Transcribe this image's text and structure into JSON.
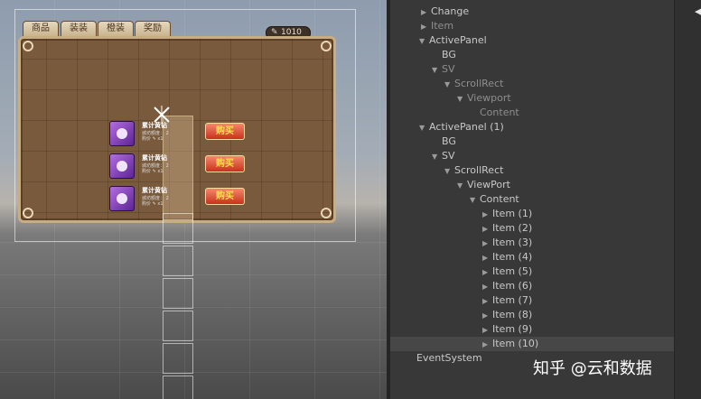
{
  "scene": {
    "tabs": [
      "商品",
      "装装",
      "橙装",
      "奖励"
    ],
    "coin_amount": "1010",
    "items": [
      {
        "title": "累计黄钻",
        "desc": "城坊额度： 2",
        "price_label": "购价",
        "price": "x1",
        "buy_label": "购买"
      },
      {
        "title": "累计黄钻",
        "desc": "城坊额度： 2",
        "price_label": "购价",
        "price": "x1",
        "buy_label": "购买"
      },
      {
        "title": "累计黄钻",
        "desc": "城坊额度： 2",
        "price_label": "购价",
        "price": "x1",
        "buy_label": "购买"
      }
    ]
  },
  "hierarchy": {
    "rows": [
      {
        "label": "Change",
        "expander": "right",
        "dim": false,
        "selected": false
      },
      {
        "label": "Item",
        "expander": "right",
        "dim": true,
        "selected": false
      },
      {
        "label": "ActivePanel",
        "expander": "down",
        "dim": false,
        "selected": false
      },
      {
        "label": "BG",
        "expander": "none",
        "dim": false,
        "selected": false
      },
      {
        "label": "SV",
        "expander": "down",
        "dim": true,
        "selected": false
      },
      {
        "label": "ScrollRect",
        "expander": "down",
        "dim": true,
        "selected": false
      },
      {
        "label": "Viewport",
        "expander": "down",
        "dim": true,
        "selected": false
      },
      {
        "label": "Content",
        "expander": "none",
        "dim": true,
        "selected": false
      },
      {
        "label": "ActivePanel (1)",
        "expander": "down",
        "dim": false,
        "selected": false
      },
      {
        "label": "BG",
        "expander": "none",
        "dim": false,
        "selected": false
      },
      {
        "label": "SV",
        "expander": "down",
        "dim": false,
        "selected": false
      },
      {
        "label": "ScrollRect",
        "expander": "down",
        "dim": false,
        "selected": false
      },
      {
        "label": "ViewPort",
        "expander": "down",
        "dim": false,
        "selected": false
      },
      {
        "label": "Content",
        "expander": "down",
        "dim": false,
        "selected": false
      },
      {
        "label": "Item (1)",
        "expander": "right",
        "dim": false,
        "selected": false
      },
      {
        "label": "Item (2)",
        "expander": "right",
        "dim": false,
        "selected": false
      },
      {
        "label": "Item (3)",
        "expander": "right",
        "dim": false,
        "selected": false
      },
      {
        "label": "Item (4)",
        "expander": "right",
        "dim": false,
        "selected": false
      },
      {
        "label": "Item (5)",
        "expander": "right",
        "dim": false,
        "selected": false
      },
      {
        "label": "Item (6)",
        "expander": "right",
        "dim": false,
        "selected": false
      },
      {
        "label": "Item (7)",
        "expander": "right",
        "dim": false,
        "selected": false
      },
      {
        "label": "Item (8)",
        "expander": "right",
        "dim": false,
        "selected": false
      },
      {
        "label": "Item (9)",
        "expander": "right",
        "dim": false,
        "selected": false
      },
      {
        "label": "Item (10)",
        "expander": "right",
        "dim": false,
        "selected": true
      },
      {
        "label": "EventSystem",
        "expander": "none",
        "dim": false,
        "selected": false
      }
    ]
  },
  "watermark": "知乎 @云和数据",
  "icons": {
    "coin": "coin-icon",
    "item": "gem-icon",
    "gizmo": "move-gizmo-icon",
    "expand_right": "triangle-right-icon",
    "expand_down": "triangle-down-icon",
    "scroll_arrow": "arrow-left-icon"
  }
}
